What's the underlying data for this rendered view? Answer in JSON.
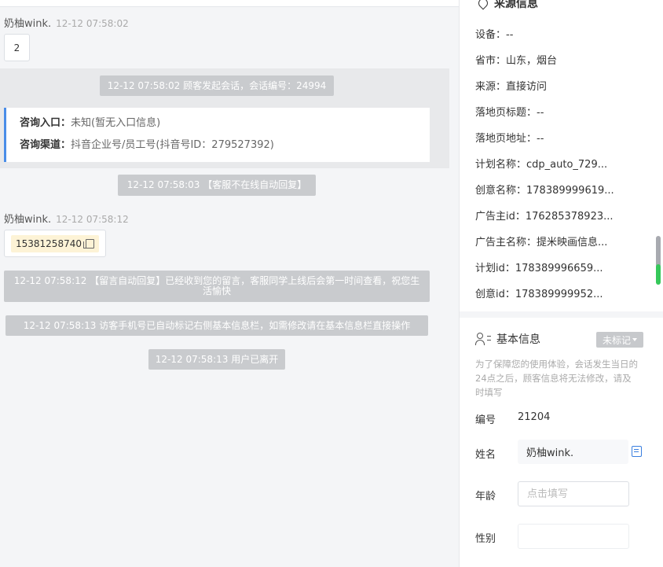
{
  "chat": {
    "msg1": {
      "sender": "奶柚wink.",
      "time": "12-12 07:58:02",
      "content": "2"
    },
    "sys1": "12-12 07:58:02 顾客发起会话，会话编号：24994",
    "entry": {
      "entry_label": "咨询入口：",
      "entry_value": "未知(暂无入口信息)",
      "channel_label": "咨询渠道：",
      "channel_value": "抖音企业号/员工号(抖音号ID：279527392)"
    },
    "sys2": "12-12 07:58:03 【客服不在线自动回复】",
    "msg2": {
      "sender": "奶柚wink.",
      "time": "12-12 07:58:12",
      "phone": "15381258740"
    },
    "sys3": "12-12 07:58:12 【留言自动回复】已经收到您的留言，客服同学上线后会第一时间查看，祝您生活愉快",
    "sys4": "12-12 07:58:13 访客手机号已自动标记右侧基本信息栏，如需修改请在基本信息栏直接操作",
    "sys5": "12-12 07:58:13 用户已离开"
  },
  "source": {
    "title": "来源信息",
    "rows": [
      "设备：--",
      "省市：山东，烟台",
      "来源：直接访问",
      "落地页标题：--",
      "落地页地址：--",
      "计划名称：cdp_auto_729...",
      "创意名称：178389999619...",
      "广告主id：176285378923...",
      "广告主名称：提米映画信息...",
      "计划id：178389996659...",
      "创意id：178389999952..."
    ]
  },
  "basic": {
    "title": "基本信息",
    "tag": "未标记",
    "hint": "为了保障您的使用体验，会话发生当日的24点之后，顾客信息将无法修改，请及时填写",
    "id_label": "编号",
    "id_value": "21204",
    "name_label": "姓名",
    "name_value": "奶柚wink.",
    "age_label": "年龄",
    "age_placeholder": "点击填写",
    "gender_label": "性别"
  },
  "colors": {
    "accent": "#4a8de8",
    "system_msg": "#c9cbce",
    "phone_highlight": "#fdf3d6",
    "scroll_indicator": "#36c85a"
  }
}
